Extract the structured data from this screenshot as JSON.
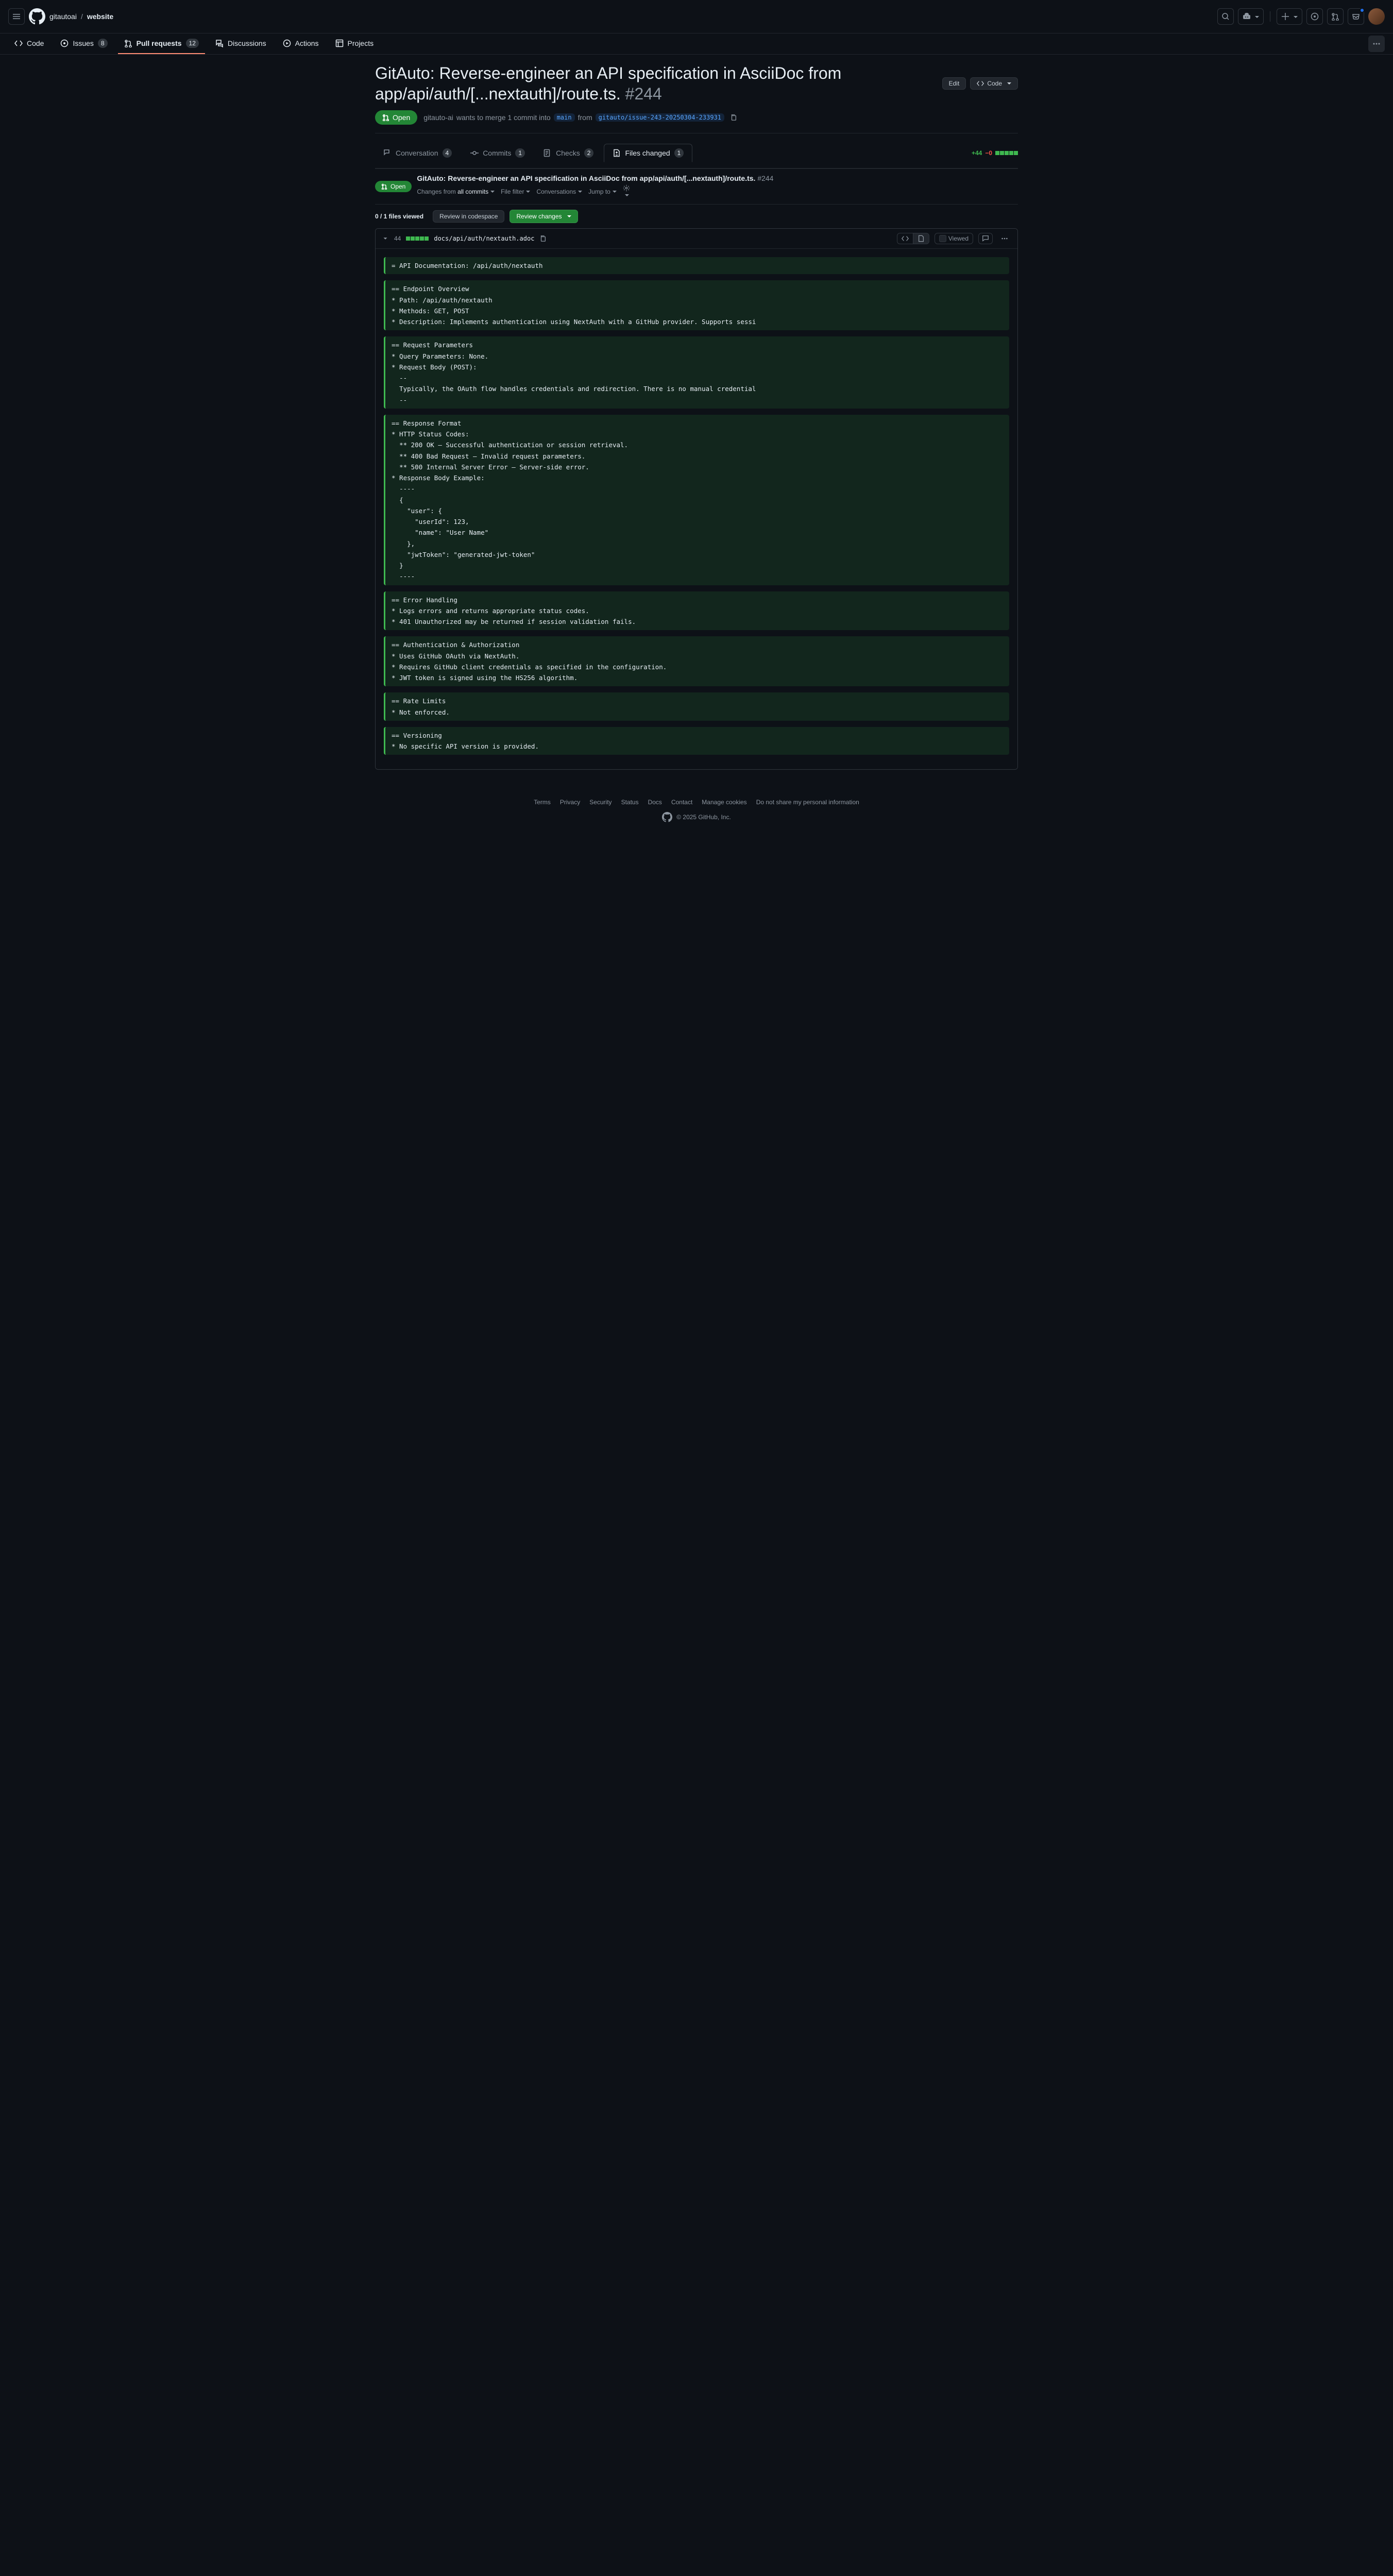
{
  "header": {
    "owner": "gitautoai",
    "repo": "website"
  },
  "nav": {
    "code": "Code",
    "issues": "Issues",
    "issues_count": "8",
    "pulls": "Pull requests",
    "pulls_count": "12",
    "discussions": "Discussions",
    "actions": "Actions",
    "projects": "Projects"
  },
  "pr": {
    "title": "GitAuto: Reverse-engineer an API specification in AsciiDoc from app/api/auth/[...nextauth]/route.ts.",
    "number": "#244",
    "state": "Open",
    "author": "gitauto-ai",
    "merge_text_1": "wants to merge 1 commit into",
    "base_branch": "main",
    "merge_text_2": "from",
    "head_branch": "gitauto/issue-243-20250304-233931",
    "edit": "Edit",
    "code_btn": "Code"
  },
  "tabs": {
    "conversation": "Conversation",
    "conversation_count": "4",
    "commits": "Commits",
    "commits_count": "1",
    "checks": "Checks",
    "checks_count": "2",
    "files": "Files changed",
    "files_count": "1",
    "add": "+44",
    "del": "−0"
  },
  "sticky": {
    "changes_from": "Changes from",
    "all_commits": "all commits",
    "file_filter": "File filter",
    "conversations": "Conversations",
    "jump_to": "Jump to",
    "files_viewed": "0 / 1 files viewed",
    "review_codespace": "Review in codespace",
    "review_changes": "Review changes"
  },
  "file": {
    "count": "44",
    "name": "docs/api/auth/nextauth.adoc",
    "viewed": "Viewed"
  },
  "hunks": [
    "= API Documentation: /api/auth/nextauth",
    "== Endpoint Overview\n* Path: /api/auth/nextauth\n* Methods: GET, POST\n* Description: Implements authentication using NextAuth with a GitHub provider. Supports sessi",
    "== Request Parameters\n* Query Parameters: None.\n* Request Body (POST):\n  --\n  Typically, the OAuth flow handles credentials and redirection. There is no manual credential\n  --",
    "== Response Format\n* HTTP Status Codes:\n  ** 200 OK – Successful authentication or session retrieval.\n  ** 400 Bad Request – Invalid request parameters.\n  ** 500 Internal Server Error – Server-side error.\n* Response Body Example:\n  ----\n  {\n    \"user\": {\n      \"userId\": 123,\n      \"name\": \"User Name\"\n    },\n    \"jwtToken\": \"generated-jwt-token\"\n  }\n  ----",
    "== Error Handling\n* Logs errors and returns appropriate status codes.\n* 401 Unauthorized may be returned if session validation fails.",
    "== Authentication & Authorization\n* Uses GitHub OAuth via NextAuth.\n* Requires GitHub client credentials as specified in the configuration.\n* JWT token is signed using the HS256 algorithm.",
    "== Rate Limits\n* Not enforced.",
    "== Versioning\n* No specific API version is provided."
  ],
  "footer": {
    "links": [
      "Terms",
      "Privacy",
      "Security",
      "Status",
      "Docs",
      "Contact",
      "Manage cookies",
      "Do not share my personal information"
    ],
    "copy": "© 2025 GitHub, Inc."
  }
}
